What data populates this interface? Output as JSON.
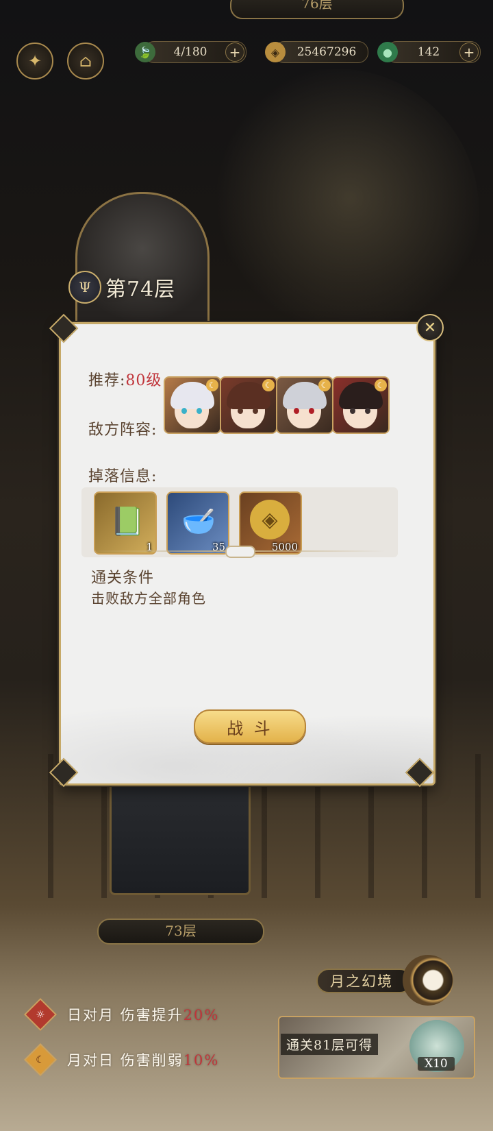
{
  "top_floor_pill": "76层",
  "resources": [
    {
      "icon": "leaf-icon",
      "value": "4/180",
      "glyph": "🍃"
    },
    {
      "icon": "coin-icon",
      "value": "25467296",
      "glyph": "◈"
    },
    {
      "icon": "jade-icon",
      "value": "142",
      "glyph": "●"
    }
  ],
  "top_buttons": {
    "left_glyph": "✦",
    "right_glyph": "⌂"
  },
  "floor_header": {
    "badge": "Ψ",
    "title": "第74层"
  },
  "dialog": {
    "recommend_label": "推荐:",
    "recommend_value": "80级",
    "enemy_label": "敌方阵容:",
    "enemies": [
      {
        "name": "enemy-1",
        "hair": "#e7e7ef",
        "eye": "#3ab1c9",
        "bg": "#b67b49"
      },
      {
        "name": "enemy-2",
        "hair": "#5a2f22",
        "eye": "#5a3527",
        "bg": "#7a3a2a"
      },
      {
        "name": "enemy-3",
        "hair": "#cfd1d8",
        "eye": "#b01e26",
        "bg": "#7b5a44"
      },
      {
        "name": "enemy-4",
        "hair": "#2a1e1c",
        "eye": "#3b3030",
        "bg": "#8a2f2a"
      }
    ],
    "drops_label": "掉落信息:",
    "drops": [
      {
        "name": "book-item",
        "count": "1",
        "glyph": "📗"
      },
      {
        "name": "elixir-bowl-item",
        "count": "35",
        "glyph": "🥣"
      },
      {
        "name": "copper-coin-item",
        "count": "5000",
        "glyph": "◈"
      }
    ],
    "clear_condition_title": "通关条件",
    "clear_condition_text": "击败敌方全部角色",
    "fight_label": "战 斗",
    "close_glyph": "✕"
  },
  "lower_floor_pill": "73层",
  "buffs": [
    {
      "icon": "sun-icon",
      "glyph": "☼",
      "text": "日对月 伤害提升",
      "pct": "20%"
    },
    {
      "icon": "moon-icon",
      "glyph": "☾",
      "text": "月对日 伤害削弱",
      "pct": "10%"
    }
  ],
  "moon_realm_label": "月之幻境",
  "reward": {
    "text": "通关81层可得",
    "count": "X10"
  },
  "colors": {
    "gold": "#c6a968",
    "red_value": "#c0343a",
    "brown_text": "#5a4330"
  }
}
